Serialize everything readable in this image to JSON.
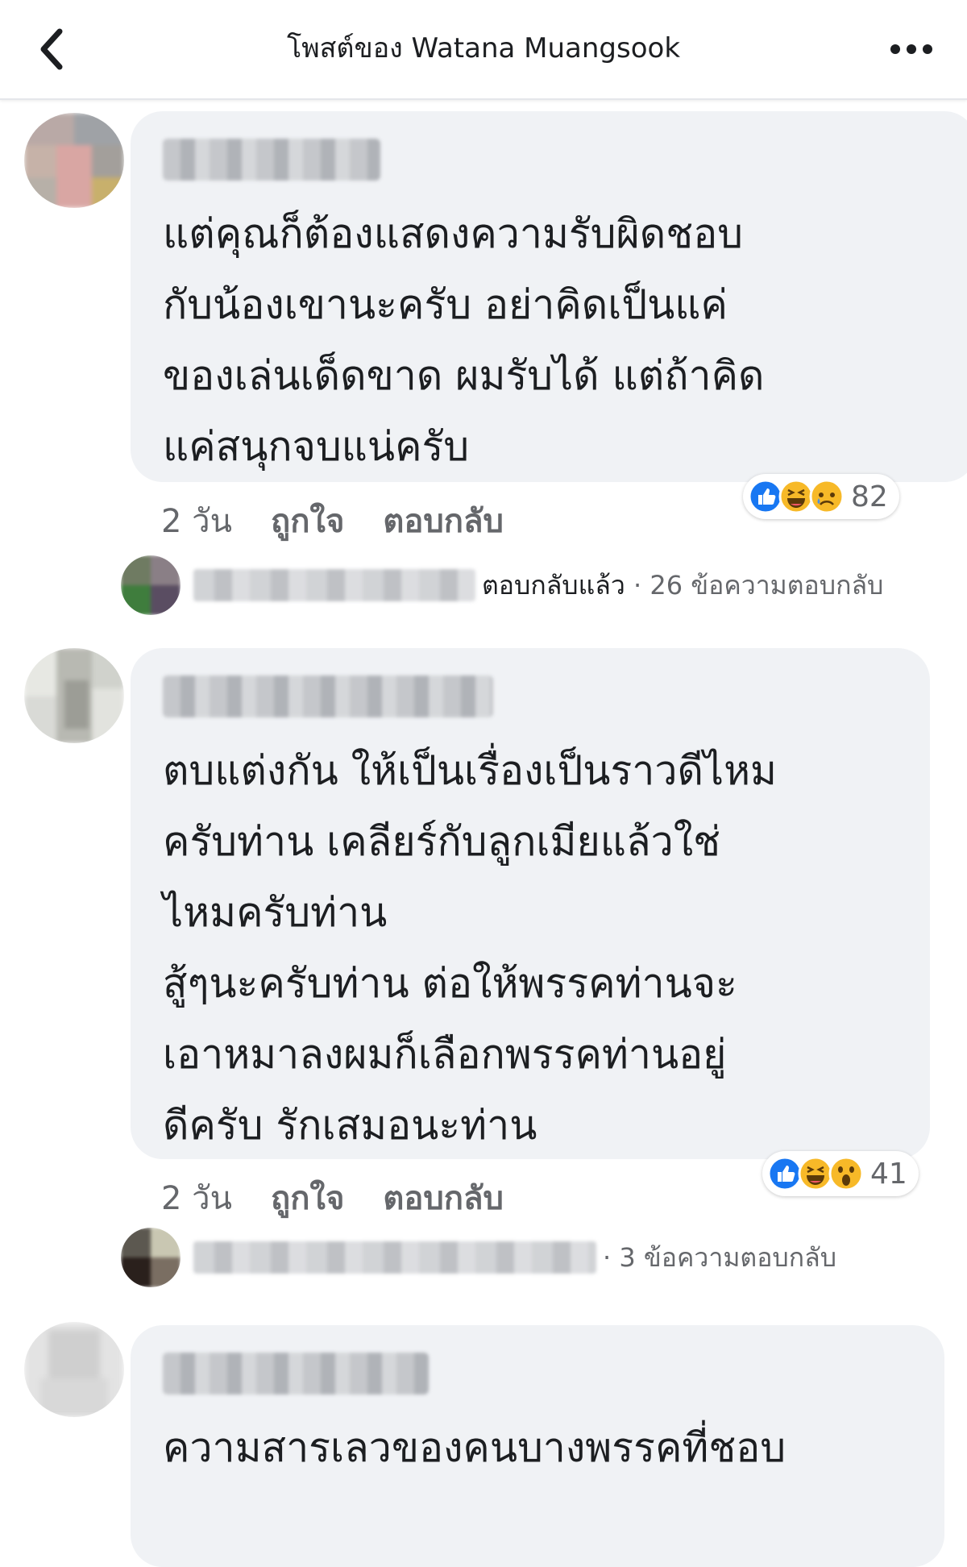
{
  "header": {
    "title": "โพสต์ของ Watana Muangsook"
  },
  "comments": [
    {
      "text": "แต่คุณก็ต้องแสดงความรับผิดชอบ\nกับน้องเขานะครับ อย่าคิดเป็นแค่\nของเล่นเด็ดขาด ผมรับได้ แต่ถ้าคิด\nแค่สนุกจบแน่ครับ",
      "time": "2 วัน",
      "like_label": "ถูกใจ",
      "reply_label": "ตอบกลับ",
      "reactions": [
        "like",
        "haha",
        "sad"
      ],
      "reaction_count": "82",
      "replied_label": "ตอบกลับแล้ว",
      "reply_count_label": "· 26 ข้อความตอบกลับ"
    },
    {
      "text": "ตบแต่งกัน ให้เป็นเรื่องเป็นราวดีไหม\nครับท่าน เคลียร์กับลูกเมียแล้วใช่\nไหมครับท่าน\nสู้ๆนะครับท่าน ต่อให้พรรคท่านจะ\nเอาหมาลงผมก็เลือกพรรคท่านอยู่\nดีครับ รักเสมอนะท่าน",
      "time": "2 วัน",
      "like_label": "ถูกใจ",
      "reply_label": "ตอบกลับ",
      "reactions": [
        "like",
        "haha",
        "wow"
      ],
      "reaction_count": "41",
      "reply_count_label": "· 3 ข้อความตอบกลับ"
    },
    {
      "text": "ความสารเลวของคนบางพรรคที่ชอบ"
    }
  ],
  "colors": {
    "bubble": "#f0f2f5",
    "meta_text": "#65676b",
    "like_blue": "#1877f2",
    "reaction_yellow": "#f7b928"
  }
}
